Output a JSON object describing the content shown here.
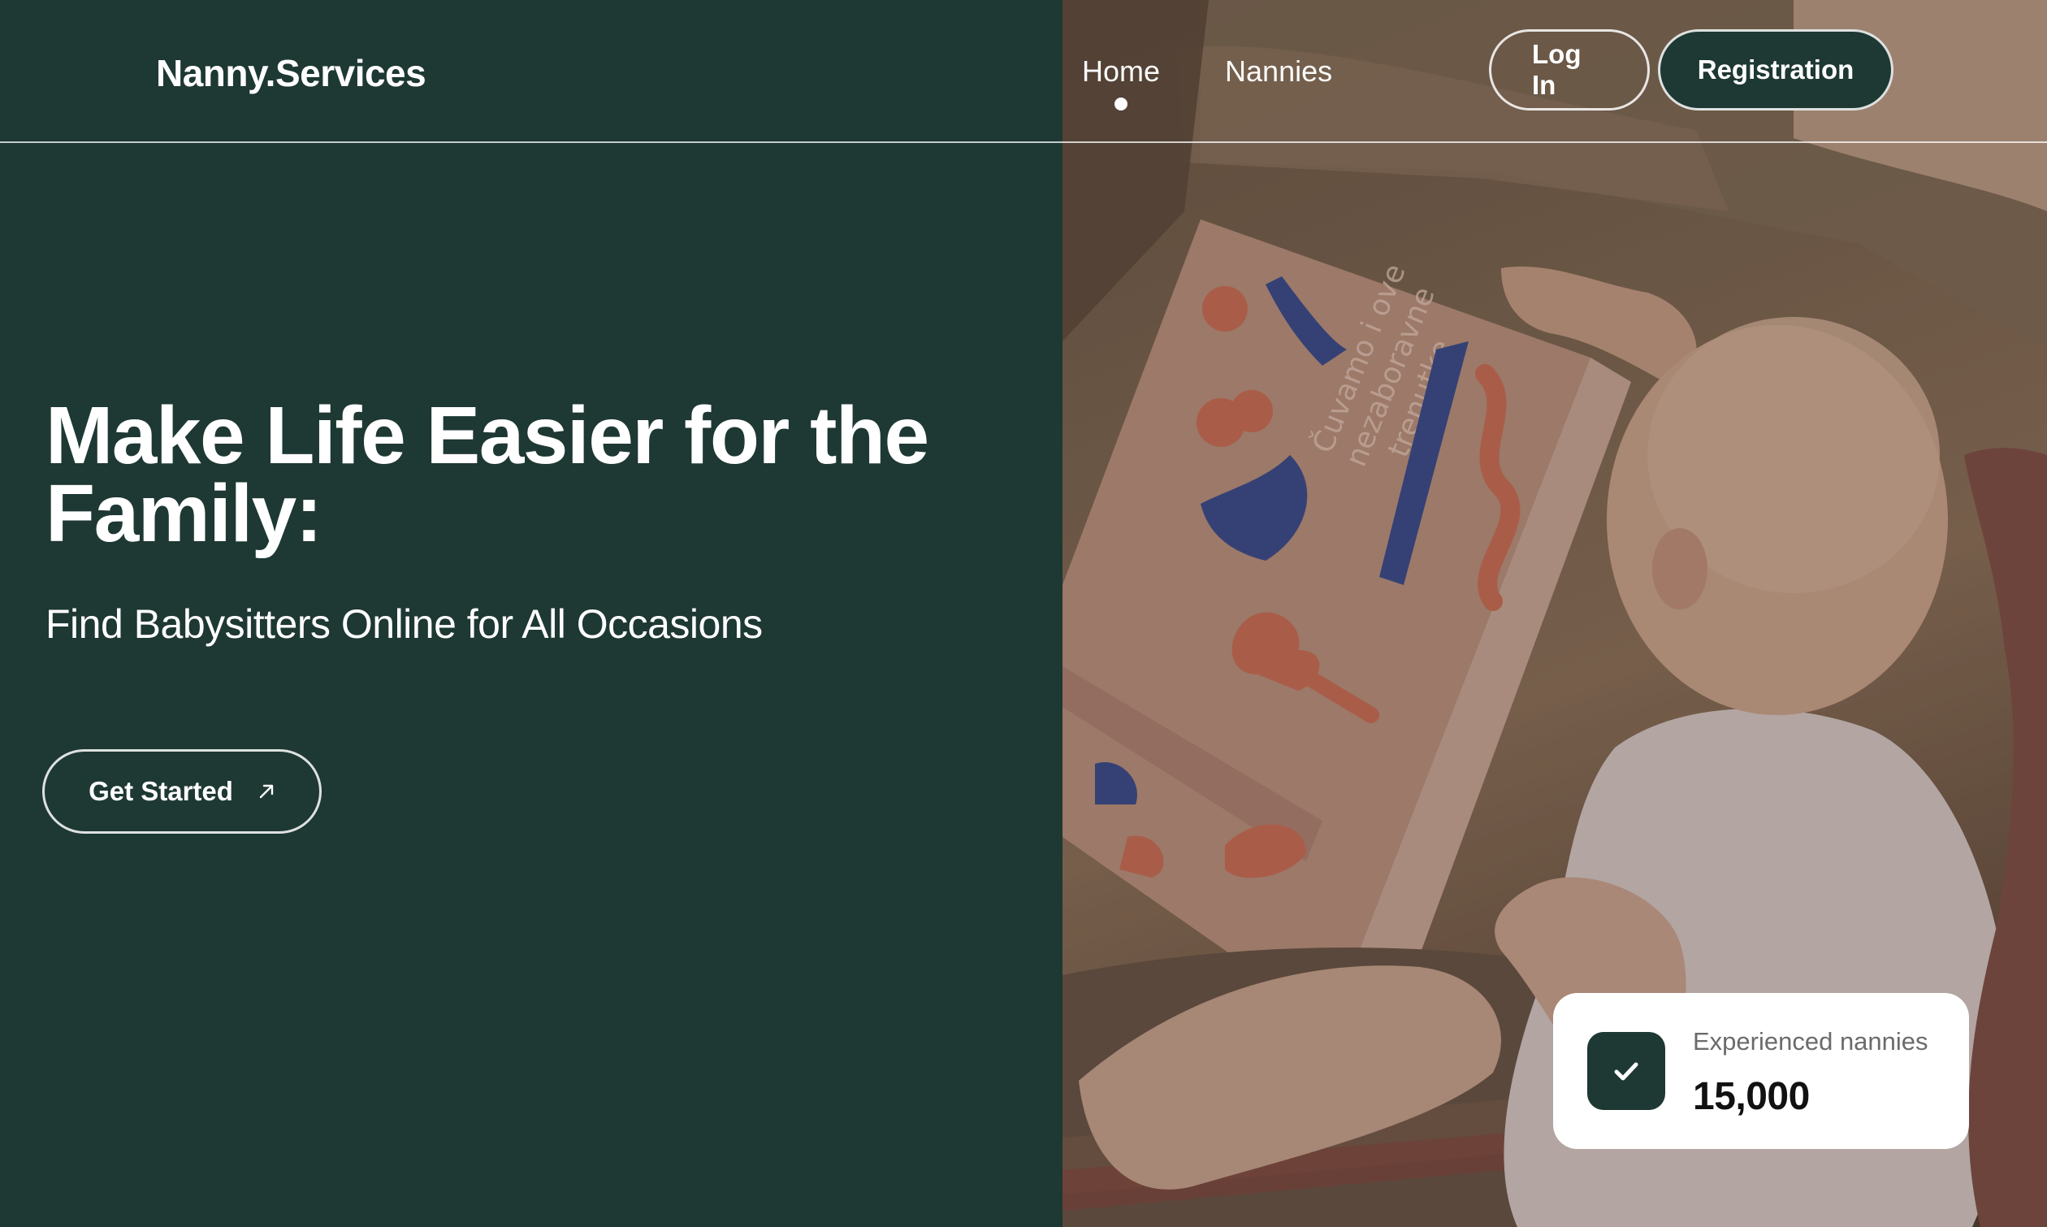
{
  "brand": {
    "logo_text": "Nanny.Services"
  },
  "nav": {
    "items": [
      {
        "label": "Home",
        "active": true
      },
      {
        "label": "Nannies",
        "active": false
      }
    ]
  },
  "auth": {
    "login_label": "Log In",
    "register_label": "Registration"
  },
  "hero": {
    "title": "Make Life Easier for the Family:",
    "subtitle": "Find Babysitters Online for All Occasions",
    "cta_label": "Get Started",
    "cta_icon": "arrow-up-right-icon"
  },
  "stats": {
    "label": "Experienced nannies",
    "value": "15,000",
    "icon": "check-icon"
  },
  "colors": {
    "primary": "#1e3833",
    "text_light": "#ffffff",
    "card_bg": "#ffffff"
  }
}
